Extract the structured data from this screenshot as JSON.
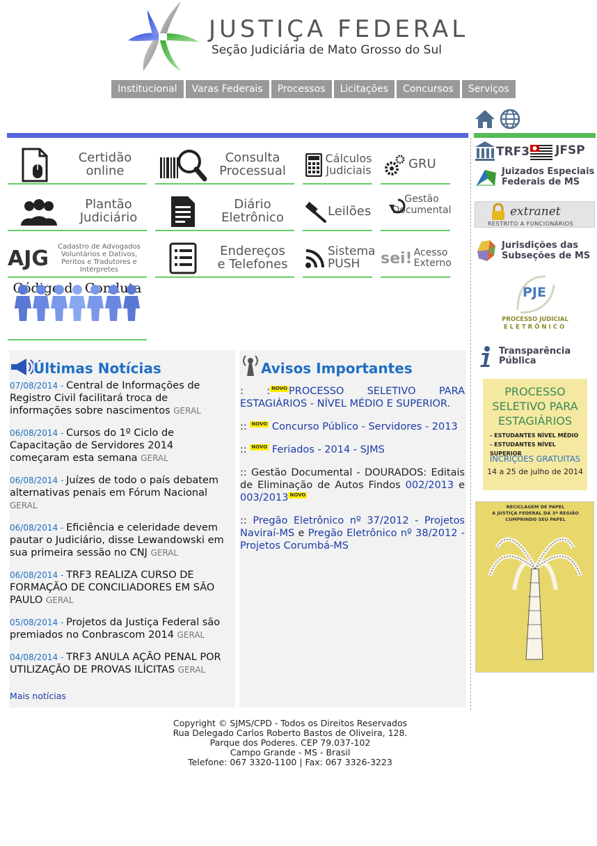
{
  "header": {
    "title": "JUSTIÇA FEDERAL",
    "subtitle": "Seção Judiciária de Mato Grosso do Sul"
  },
  "nav": {
    "items": [
      "Institucional",
      "Varas Federais",
      "Processos",
      "Licitações",
      "Concursos",
      "Serviços"
    ]
  },
  "services": {
    "certidao": [
      "Certidão",
      "online"
    ],
    "consulta": [
      "Consulta",
      "Processual"
    ],
    "calculos": [
      "Cálculos",
      "Judiciais"
    ],
    "gru": "GRU",
    "plantao": [
      "Plantão",
      "Judiciário"
    ],
    "diario": [
      "Diário",
      "Eletrônico"
    ],
    "leiloes": "Leilões",
    "gestao": [
      "Gestão",
      "Documental"
    ],
    "ajg": "AJG",
    "ajg_desc": [
      "Cadastro de Advogados",
      "Voluntários e Dativos,",
      "Peritos e Tradutores e",
      "Intérpretes"
    ],
    "enderecos": [
      "Endereços",
      "e Telefones"
    ],
    "push": [
      "Sistema",
      "PUSH"
    ],
    "sei_logo": "sei!",
    "sei": [
      "Acesso",
      "Externo"
    ],
    "conduta": "Código de Conduta"
  },
  "news": {
    "title": "Últimas Notícias",
    "items": [
      {
        "date": "07/08/2014 - ",
        "text": "Central de Informações de Registro Civil facilitará troca de informações sobre nascimentos",
        "tag": "GERAL"
      },
      {
        "date": "06/08/2014 - ",
        "text": "Cursos do 1º Ciclo de Capacitação de Servidores 2014 começaram esta semana",
        "tag": "GERAL"
      },
      {
        "date": "06/08/2014 - ",
        "text": "Juízes de todo o país debatem alternativas penais em Fórum Nacional",
        "tag": "GERAL"
      },
      {
        "date": "06/08/2014 - ",
        "text": "Eficiência e celeridade devem pautar o Judiciário, disse Lewandowski em sua primeira sessão no CNJ",
        "tag": "GERAL"
      },
      {
        "date": "06/08/2014 - ",
        "text": "TRF3 REALIZA CURSO DE FORMAÇÃO DE CONCILIADORES EM SÃO PAULO",
        "tag": "GERAL"
      },
      {
        "date": "05/08/2014 - ",
        "text": "Projetos da Justiça Federal são premiados no Conbrascom 2014",
        "tag": "GERAL"
      },
      {
        "date": "04/08/2014 - ",
        "text": "TRF3 ANULA AÇÃO PENAL POR UTILIZAÇÃO DE PROVAS ILÍCITAS",
        "tag": "GERAL"
      }
    ],
    "more": "Mais notícias"
  },
  "avisos": {
    "title": "Avisos Importantes",
    "novo_badge": "NOVO",
    "a1_prefix": ":   :",
    "a1_link": "PROCESSO SELETIVO PARA ESTAGIÁRIOS - NÍVEL MÉDIO E SUPERIOR.",
    "a2_prefix": "::",
    "a2_link": "Concurso Público - Servidores - 2013",
    "a3_prefix": "::",
    "a3_link": "Feriados - 2014 - SJMS",
    "a4_text": ":: Gestão Documental - DOURADOS: Editais de Eliminação de Autos Findos",
    "a4_link1": "002/2013",
    "a4_and": " e ",
    "a4_link2": "003/2013",
    "a5_prefix": "::",
    "a5_link1": "Pregão Eletrônico nº 37/2012 - Projetos Naviraí-MS",
    "a5_and": " e ",
    "a5_link2": "Pregão Eletrônico nº 38/2012 - Projetos Corumbá-MS"
  },
  "sidebar": {
    "trf3": "TRF3",
    "jfsp": "JFSP",
    "juizados": [
      "Juizados Especiais",
      "Federais de MS"
    ],
    "extranet": "extranet",
    "extranet_sub": "RESTRITO A FUNCIONÁRIOS",
    "jurisdicoes": [
      "Jurisdições das",
      "Subseções de MS"
    ],
    "pje_logo": "PJE",
    "pje": [
      "PROCESSO JUDICIAL",
      "ELETRÔNICO"
    ],
    "transparencia": [
      "Transparência",
      "Pública"
    ],
    "banner": {
      "title": [
        "PROCESSO",
        "SELETIVO PARA",
        "ESTAGIÁRIOS"
      ],
      "items": [
        "- ESTUDANTES NÍVEL MÉDIO",
        "- ESTUDANTES NÍVEL SUPERIOR"
      ],
      "free": "INCRIÇÕES GRATUITAS",
      "dates": "14 a 25 de julho de 2014"
    },
    "poster_heading": [
      "RECICLAGEM DE PAPEL",
      "A JUSTIÇA FEDERAL DA 3ª REGIÃO",
      "CUMPRINDO SEU PAPEL"
    ]
  },
  "footer": {
    "lines": [
      "Copyright © SJMS/CPD - Todos os Direitos Reservados",
      "Rua Delegado Carlos Roberto Bastos de Oliveira, 128.",
      "Parque dos Poderes. CEP 79.037-102",
      "Campo Grande - MS - Brasil",
      "Telefone: 067 3320-1100 | Fax: 067 3326-3223"
    ]
  },
  "colors": {
    "accent_blue": "#5566dd",
    "accent_green": "#66cc66",
    "link": "#1a3aa8",
    "news_title": "#1f6fc4",
    "nav_bg": "#999999"
  }
}
